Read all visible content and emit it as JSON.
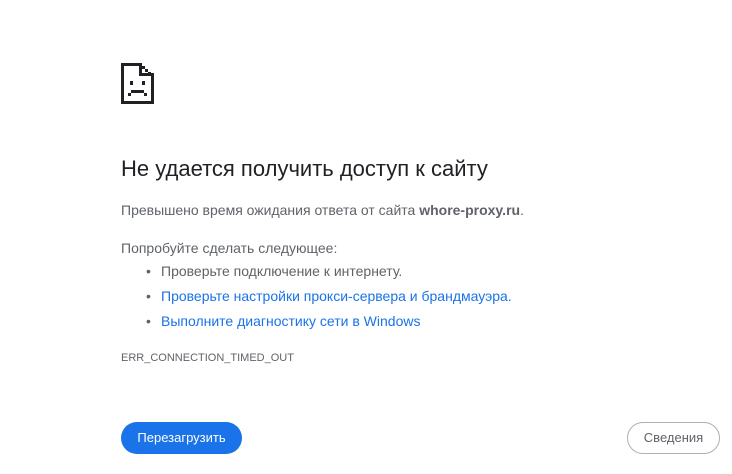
{
  "error": {
    "icon": "sad-page-icon",
    "heading": "Не удается получить доступ к сайту",
    "summary_prefix": "Превышено время ожидания ответа от сайта ",
    "summary_host": "whore-proxy.ru",
    "summary_suffix": ".",
    "suggestions_title": "Попробуйте сделать следующее:",
    "suggestions": [
      {
        "bullet": "•",
        "label": "Проверьте подключение к интернету.",
        "link": false
      },
      {
        "bullet": "•",
        "label": "Проверьте настройки прокси-сервера и брандмауэра.",
        "link": true
      },
      {
        "bullet": "•",
        "label": "Выполните диагностику сети в Windows",
        "link": true
      }
    ],
    "code": "ERR_CONNECTION_TIMED_OUT"
  },
  "buttons": {
    "reload_label": "Перезагрузить",
    "details_label": "Сведения"
  },
  "colors": {
    "accent": "#1a73e8",
    "heading_text": "#202124",
    "body_text": "#5f6368"
  }
}
